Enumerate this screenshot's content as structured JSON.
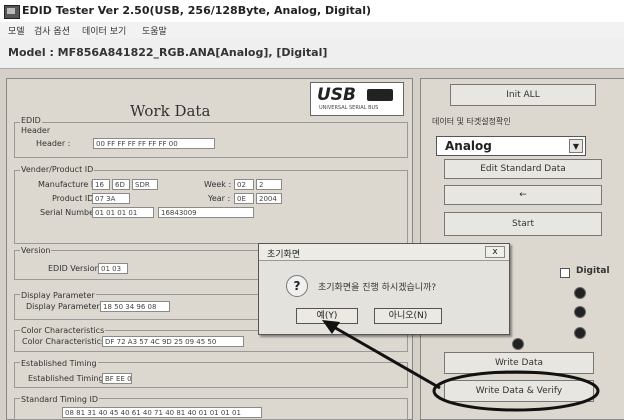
{
  "window": {
    "title": "EDID Tester Ver 2.50(USB, 256/128Byte, Analog, Digital)"
  },
  "menu": {
    "items": [
      "모델",
      "검사 옵션",
      "데이터 보기",
      "도움말"
    ]
  },
  "model_line": "Model : MF856A841822_RGB.ANA[Analog], [Digital]",
  "work": {
    "title": "Work Data",
    "logo": {
      "text": "USB",
      "subtext": "UNIVERSAL SERIAL BUS"
    },
    "edid_group": "EDID",
    "header_group": "Header",
    "header_label": "Header :",
    "header_value": "00 FF FF FF FF FF FF 00",
    "vendor_group": "Vender/Product ID",
    "manufacture_label": "Manufacture ID :",
    "manufacture_values": [
      "16",
      "6D",
      "SDR"
    ],
    "week_label": "Week :",
    "week_values": [
      "02",
      "2"
    ],
    "product_label": "Product ID :",
    "product_value": "07 3A",
    "year_label": "Year :",
    "year_values": [
      "0E",
      "2004"
    ],
    "serial_label": "Serial Number :",
    "serial_value": "01 01 01 01",
    "serial_value2": "16843009",
    "version_group": "Version",
    "version_label": "EDID Version :",
    "version_value": "01 03",
    "display_group": "Display Parameter",
    "display_label": "Display Parameter :",
    "display_value": "18 50 34 96 08",
    "color_group": "Color Characteristics",
    "color_label": "Color Characteristics :",
    "color_value": "DF 72 A3 57 4C 9D 25 09 45 50",
    "est_group": "Established Timing",
    "est_label": "Established Timing :",
    "est_value": "BF EE 00",
    "std_group": "Standard Timing ID",
    "std_value": "08 81 31 40 45 40 61 40 71 40 81 40 01 01 01 01"
  },
  "right": {
    "init_label": "Init ALL",
    "section_label": "데이터 및 타겟설정확인",
    "combo_value": "Analog",
    "edit_std_label": "Edit Standard Data",
    "arrow_label": "←",
    "start_label": "Start",
    "digital_label": "Digital",
    "write_data_label": "Write Data",
    "write_verify_label": "Write Data & Verify"
  },
  "dialog": {
    "title": "초기화면",
    "message": "초기화면을 진행 하시겠습니까?",
    "yes_label": "예(Y)",
    "no_label": "아니오(N)",
    "close_label": "x"
  },
  "colors": {
    "annotation": "#111111",
    "window_bg": "#d4d0c8"
  }
}
